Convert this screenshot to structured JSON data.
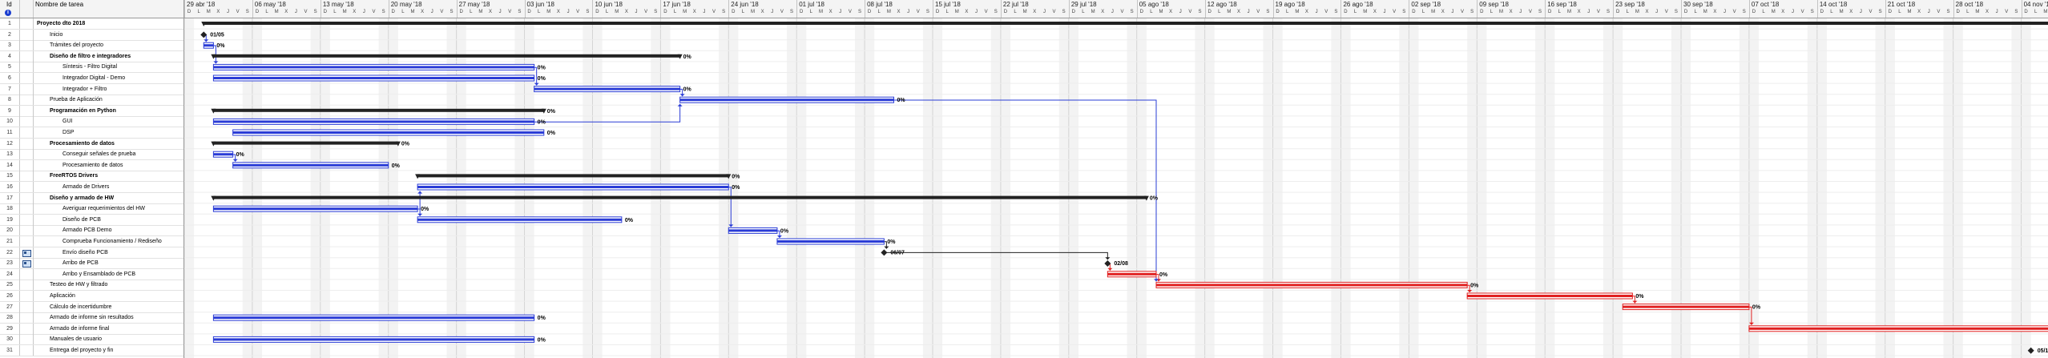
{
  "header": {
    "id_label": "Id",
    "info_icon": "info-icon",
    "name_label": "Nombre de tarea"
  },
  "timescale": {
    "weeks": [
      "29 abr '18",
      "06 may '18",
      "13 may '18",
      "20 may '18",
      "27 may '18",
      "03 jun '18",
      "10 jun '18",
      "17 jun '18",
      "24 jun '18",
      "01 jul '18",
      "08 jul '18",
      "15 jul '18",
      "22 jul '18",
      "29 jul '18",
      "05 ago '18",
      "12 ago '18",
      "19 ago '18",
      "26 ago '18",
      "02 sep '18",
      "09 sep '18",
      "16 sep '18",
      "23 sep '18",
      "30 sep '18",
      "07 oct '18",
      "14 oct '18",
      "21 oct '18",
      "28 oct '18",
      "04 nov '18"
    ],
    "days": [
      "D",
      "L",
      "M",
      "X",
      "J",
      "V",
      "S"
    ]
  },
  "tasks": [
    {
      "id": "1",
      "name": "Proyecto dto 2018",
      "level": 0,
      "summary": true,
      "indicator": false
    },
    {
      "id": "2",
      "name": "Inicio",
      "level": 1,
      "summary": false,
      "indicator": false
    },
    {
      "id": "3",
      "name": "Trámites del proyecto",
      "level": 1,
      "summary": false,
      "indicator": false
    },
    {
      "id": "4",
      "name": "Diseño de filtro e integradores",
      "level": 1,
      "summary": true,
      "indicator": false
    },
    {
      "id": "5",
      "name": "Síntesis - Filtro Digital",
      "level": 2,
      "summary": false,
      "indicator": false
    },
    {
      "id": "6",
      "name": "Integrador Digital - Demo",
      "level": 2,
      "summary": false,
      "indicator": false
    },
    {
      "id": "7",
      "name": "Integrador + Filtro",
      "level": 2,
      "summary": false,
      "indicator": false
    },
    {
      "id": "8",
      "name": "Prueba de Aplicación",
      "level": 1,
      "summary": false,
      "indicator": false
    },
    {
      "id": "9",
      "name": "Programación en Python",
      "level": 1,
      "summary": true,
      "indicator": false
    },
    {
      "id": "10",
      "name": "GUI",
      "level": 2,
      "summary": false,
      "indicator": false
    },
    {
      "id": "11",
      "name": "DSP",
      "level": 2,
      "summary": false,
      "indicator": false
    },
    {
      "id": "12",
      "name": "Procesamiento de datos",
      "level": 1,
      "summary": true,
      "indicator": false
    },
    {
      "id": "13",
      "name": "Conseguir señales de prueba",
      "level": 2,
      "summary": false,
      "indicator": false
    },
    {
      "id": "14",
      "name": "Procesamiento de datos",
      "level": 2,
      "summary": false,
      "indicator": false
    },
    {
      "id": "15",
      "name": "FreeRTOS Drivers",
      "level": 1,
      "summary": true,
      "indicator": false
    },
    {
      "id": "16",
      "name": "Armado de Drivers",
      "level": 2,
      "summary": false,
      "indicator": false
    },
    {
      "id": "17",
      "name": "Diseño y armado de HW",
      "level": 1,
      "summary": true,
      "indicator": false
    },
    {
      "id": "18",
      "name": "Averiguar requerimientos del HW",
      "level": 2,
      "summary": false,
      "indicator": false
    },
    {
      "id": "19",
      "name": "Diseño de PCB",
      "level": 2,
      "summary": false,
      "indicator": false
    },
    {
      "id": "20",
      "name": "Armado PCB Demo",
      "level": 2,
      "summary": false,
      "indicator": false
    },
    {
      "id": "21",
      "name": "Comprueba Funcionamiento / Rediseño",
      "level": 2,
      "summary": false,
      "indicator": false
    },
    {
      "id": "22",
      "name": "Envío diseño PCB",
      "level": 2,
      "summary": false,
      "indicator": true
    },
    {
      "id": "23",
      "name": "Arribo de PCB",
      "level": 2,
      "summary": false,
      "indicator": true
    },
    {
      "id": "24",
      "name": "Arribo y Ensamblado de PCB",
      "level": 2,
      "summary": false,
      "indicator": false
    },
    {
      "id": "25",
      "name": "Testeo de HW y filtrado",
      "level": 1,
      "summary": false,
      "indicator": false
    },
    {
      "id": "26",
      "name": "Aplicación",
      "level": 1,
      "summary": false,
      "indicator": false
    },
    {
      "id": "27",
      "name": "Cálculo de incertidumbre",
      "level": 1,
      "summary": false,
      "indicator": false
    },
    {
      "id": "28",
      "name": "Armado de informe sin resultados",
      "level": 1,
      "summary": false,
      "indicator": false
    },
    {
      "id": "29",
      "name": "Armado de informe final",
      "level": 1,
      "summary": false,
      "indicator": false
    },
    {
      "id": "30",
      "name": "Manuales de usuario",
      "level": 1,
      "summary": false,
      "indicator": false
    },
    {
      "id": "31",
      "name": "Entrega del proyecto y fin",
      "level": 1,
      "summary": false,
      "indicator": false
    }
  ],
  "bars": [
    {
      "row": 1,
      "type": "summary",
      "start": "2018-05-01",
      "end": "2018-11-07",
      "label": "0%",
      "color": "#222222"
    },
    {
      "row": 2,
      "type": "milestone",
      "start": "2018-05-01",
      "label": "01/05",
      "color": "#222222"
    },
    {
      "row": 3,
      "type": "task",
      "start": "2018-05-01",
      "end": "2018-05-02",
      "label": "0%",
      "color": "#2a3cd6"
    },
    {
      "row": 4,
      "type": "summary",
      "start": "2018-05-02",
      "end": "2018-06-19",
      "label": "0%",
      "color": "#222222"
    },
    {
      "row": 5,
      "type": "task",
      "start": "2018-05-02",
      "end": "2018-06-04",
      "label": "0%",
      "color": "#2a3cd6"
    },
    {
      "row": 6,
      "type": "task",
      "start": "2018-05-02",
      "end": "2018-06-04",
      "label": "0%",
      "color": "#2a3cd6"
    },
    {
      "row": 7,
      "type": "task",
      "start": "2018-06-04",
      "end": "2018-06-19",
      "label": "0%",
      "color": "#2a3cd6"
    },
    {
      "row": 8,
      "type": "task",
      "start": "2018-06-19",
      "end": "2018-07-11",
      "label": "0%",
      "color": "#2a3cd6"
    },
    {
      "row": 9,
      "type": "summary",
      "start": "2018-05-02",
      "end": "2018-06-05",
      "label": "0%",
      "color": "#222222"
    },
    {
      "row": 10,
      "type": "task",
      "start": "2018-05-02",
      "end": "2018-06-04",
      "label": "0%",
      "color": "#2a3cd6"
    },
    {
      "row": 11,
      "type": "task",
      "start": "2018-05-04",
      "end": "2018-06-05",
      "label": "0%",
      "color": "#2a3cd6"
    },
    {
      "row": 12,
      "type": "summary",
      "start": "2018-05-02",
      "end": "2018-05-21",
      "label": "0%",
      "color": "#222222"
    },
    {
      "row": 13,
      "type": "task",
      "start": "2018-05-02",
      "end": "2018-05-04",
      "label": "0%",
      "color": "#2a3cd6"
    },
    {
      "row": 14,
      "type": "task",
      "start": "2018-05-04",
      "end": "2018-05-20",
      "label": "0%",
      "color": "#2a3cd6"
    },
    {
      "row": 15,
      "type": "summary",
      "start": "2018-05-23",
      "end": "2018-06-24",
      "label": "0%",
      "color": "#222222"
    },
    {
      "row": 16,
      "type": "task",
      "start": "2018-05-23",
      "end": "2018-06-24",
      "label": "0%",
      "color": "#2a3cd6"
    },
    {
      "row": 17,
      "type": "summary",
      "start": "2018-05-02",
      "end": "2018-08-06",
      "label": "0%",
      "color": "#222222"
    },
    {
      "row": 18,
      "type": "task",
      "start": "2018-05-02",
      "end": "2018-05-23",
      "label": "0%",
      "color": "#2a3cd6"
    },
    {
      "row": 19,
      "type": "task",
      "start": "2018-05-23",
      "end": "2018-06-13",
      "label": "0%",
      "color": "#2a3cd6"
    },
    {
      "row": 20,
      "type": "task",
      "start": "2018-06-24",
      "end": "2018-06-29",
      "label": "0%",
      "color": "#2a3cd6"
    },
    {
      "row": 21,
      "type": "task",
      "start": "2018-06-29",
      "end": "2018-07-10",
      "label": "0%",
      "color": "#2a3cd6"
    },
    {
      "row": 22,
      "type": "milestone",
      "start": "2018-07-10",
      "label": "06/07",
      "color": "#222222"
    },
    {
      "row": 23,
      "type": "milestone",
      "start": "2018-08-02",
      "label": "02/08",
      "color": "#222222"
    },
    {
      "row": 24,
      "type": "task",
      "start": "2018-08-02",
      "end": "2018-08-07",
      "label": "0%",
      "color": "#e02020"
    },
    {
      "row": 25,
      "type": "task",
      "start": "2018-08-07",
      "end": "2018-09-08",
      "label": "0%",
      "color": "#e02020"
    },
    {
      "row": 26,
      "type": "task",
      "start": "2018-09-08",
      "end": "2018-09-25",
      "label": "0%",
      "color": "#e02020"
    },
    {
      "row": 27,
      "type": "task",
      "start": "2018-09-24",
      "end": "2018-10-07",
      "label": "0%",
      "color": "#e02020"
    },
    {
      "row": 28,
      "type": "task",
      "start": "2018-05-02",
      "end": "2018-06-04",
      "label": "0%",
      "color": "#2a3cd6"
    },
    {
      "row": 29,
      "type": "task",
      "start": "2018-10-07",
      "end": "2018-11-07",
      "label": "",
      "color": "#e02020"
    },
    {
      "row": 30,
      "type": "task",
      "start": "2018-05-02",
      "end": "2018-06-04",
      "label": "0%",
      "color": "#2a3cd6"
    },
    {
      "row": 31,
      "type": "milestone",
      "start": "2018-11-05",
      "label": "05/11",
      "color": "#222222"
    }
  ],
  "links": [
    {
      "from": 2,
      "to": 3,
      "color": "#2a3cd6"
    },
    {
      "from": 3,
      "to": 5,
      "color": "#2a3cd6"
    },
    {
      "from": 5,
      "to": 7,
      "color": "#2a3cd6"
    },
    {
      "from": 7,
      "to": 8,
      "color": "#2a3cd6"
    },
    {
      "from": 10,
      "to": 8,
      "color": "#2a3cd6"
    },
    {
      "from": 13,
      "to": 14,
      "color": "#2a3cd6"
    },
    {
      "from": 18,
      "to": 19,
      "color": "#2a3cd6"
    },
    {
      "from": 18,
      "to": 16,
      "color": "#2a3cd6"
    },
    {
      "from": 16,
      "to": 20,
      "color": "#2a3cd6"
    },
    {
      "from": 20,
      "to": 21,
      "color": "#2a3cd6"
    },
    {
      "from": 21,
      "to": 22,
      "color": "#222222"
    },
    {
      "from": 22,
      "to": 23,
      "color": "#222222"
    },
    {
      "from": 23,
      "to": 24,
      "color": "#e02020"
    },
    {
      "from": 24,
      "to": 25,
      "color": "#e02020"
    },
    {
      "from": 25,
      "to": 26,
      "color": "#e02020"
    },
    {
      "from": 26,
      "to": 27,
      "color": "#e02020"
    },
    {
      "from": 27,
      "to": 29,
      "color": "#e02020"
    },
    {
      "from": 29,
      "to": 31,
      "color": "#2a3cd6"
    },
    {
      "from": 8,
      "to": 25,
      "color": "#2a3cd6"
    }
  ]
}
